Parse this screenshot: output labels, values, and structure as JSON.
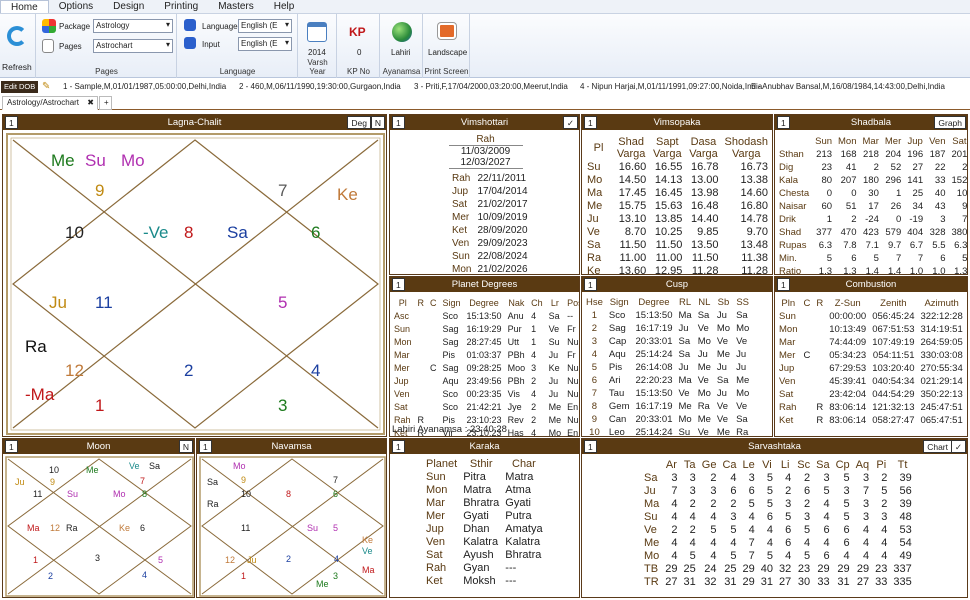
{
  "menu": [
    "Home",
    "Options",
    "Design",
    "Printing",
    "Masters",
    "Help"
  ],
  "ribbon": {
    "refresh": "Refresh",
    "package_label": "Package",
    "package_value": "Astrology",
    "pages_label": "Pages",
    "pages_value": "Astrochart",
    "pages_group": "Pages",
    "language_label": "Language",
    "language_value": "English (E",
    "input_label": "Input",
    "input_value": "English (E",
    "language_group": "Language",
    "varsh_year": "2014",
    "varsh_label": "Varsh Year",
    "kp_no": "0",
    "kp_label": "KP No",
    "ayanamsa_value": "Lahiri",
    "ayanamsa_label": "Ayanamsa",
    "print_value": "Landscape",
    "print_label": "Print Screen"
  },
  "dob": {
    "edit_label": "Edit DOB",
    "items": [
      "1 - Sample,M,01/01/1987,05:00:00,Delhi,India",
      "2 - 460,M,06/11/1990,19:30:00,Gurgaon,India",
      "3 - Priti,F,17/04/2000,03:20:00,Meerut,India",
      "4 - Nipun Harjai,M,01/11/1991,09:27:00,Noida,India",
      "5 - Anubhav Bansal,M,16/08/1984,14:43:00,Delhi,India"
    ]
  },
  "tabs": {
    "active": "Astrology/Astrochart",
    "close": "✖",
    "add": "+"
  },
  "lagna": {
    "title": "Lagna-Chalit",
    "num": "1",
    "btn1": "Deg",
    "btn2": "N",
    "houses": [
      "9",
      "7",
      "Ke",
      "10",
      "-Ve",
      "8",
      "Sa",
      "6",
      "Ju",
      "11",
      "5",
      "12",
      "2",
      "4",
      "1",
      "3"
    ],
    "planets_top": [
      "Me",
      "Su",
      "Mo"
    ],
    "left_planets": [
      "Ra",
      "-Ma"
    ]
  },
  "vimshottari": {
    "title": "Vimshottari",
    "num": "1",
    "check": "✓",
    "head": "Rah",
    "start": "11/03/2009",
    "end": "12/03/2027",
    "rows": [
      [
        "Rah",
        "22/11/2011"
      ],
      [
        "Jup",
        "17/04/2014"
      ],
      [
        "Sat",
        "21/02/2017"
      ],
      [
        "Mer",
        "10/09/2019"
      ],
      [
        "Ket",
        "28/09/2020"
      ],
      [
        "Ven",
        "29/09/2023"
      ],
      [
        "Sun",
        "22/08/2024"
      ],
      [
        "Mon",
        "21/02/2026"
      ],
      [
        "Mar",
        "12/03/2027"
      ]
    ]
  },
  "vimsopaka": {
    "title": "Vimsopaka",
    "num": "1",
    "headers": [
      "Pl",
      "Shad Varga",
      "Sapt Varga",
      "Dasa Varga",
      "Shodash Varga"
    ],
    "rows": [
      [
        "Su",
        "16.60",
        "16.55",
        "16.78",
        "16.73"
      ],
      [
        "Mo",
        "14.50",
        "14.13",
        "13.00",
        "13.38"
      ],
      [
        "Ma",
        "17.45",
        "16.45",
        "13.98",
        "14.60"
      ],
      [
        "Me",
        "15.75",
        "15.63",
        "16.48",
        "16.80"
      ],
      [
        "Ju",
        "13.10",
        "13.85",
        "14.40",
        "14.78"
      ],
      [
        "Ve",
        "8.70",
        "10.25",
        "9.85",
        "9.70"
      ],
      [
        "Sa",
        "11.50",
        "11.50",
        "13.50",
        "13.48"
      ],
      [
        "Ra",
        "11.00",
        "11.00",
        "11.50",
        "11.38"
      ],
      [
        "Ke",
        "13.60",
        "12.95",
        "11.28",
        "11.28"
      ]
    ]
  },
  "shadbala": {
    "title": "Shadbala",
    "num": "1",
    "btn": "Graph",
    "headers": [
      "",
      "Sun",
      "Mon",
      "Mar",
      "Mer",
      "Jup",
      "Ven",
      "Sat"
    ],
    "rows": [
      [
        "Sthan",
        "213",
        "168",
        "218",
        "204",
        "196",
        "187",
        "201"
      ],
      [
        "Dig",
        "23",
        "41",
        "2",
        "52",
        "27",
        "22",
        "2"
      ],
      [
        "Kala",
        "80",
        "207",
        "180",
        "296",
        "141",
        "33",
        "152"
      ],
      [
        "Chesta",
        "0",
        "0",
        "30",
        "1",
        "25",
        "40",
        "10"
      ],
      [
        "Naisar",
        "60",
        "51",
        "17",
        "26",
        "34",
        "43",
        "9"
      ],
      [
        "Drik",
        "1",
        "2",
        "-24",
        "0",
        "-19",
        "3",
        "7"
      ],
      [
        "Shad",
        "377",
        "470",
        "423",
        "579",
        "404",
        "328",
        "380"
      ],
      [
        "Rupas",
        "6.3",
        "7.8",
        "7.1",
        "9.7",
        "6.7",
        "5.5",
        "6.3"
      ],
      [
        "Min.",
        "5",
        "6",
        "5",
        "7",
        "7",
        "6",
        "5"
      ],
      [
        "Ratio",
        "1.3",
        "1.3",
        "1.4",
        "1.4",
        "1.0",
        "1.0",
        "1.3"
      ],
      [
        "Rank",
        "5",
        "3",
        "1",
        "2",
        "6",
        "7",
        "4"
      ]
    ]
  },
  "planet_degrees": {
    "title": "Planet Degrees",
    "num": "1",
    "headers": [
      "Pl",
      "R",
      "C",
      "Sign",
      "Degree",
      "Nak",
      "Ch",
      "Lr",
      "Pos"
    ],
    "rows": [
      [
        "Asc",
        "",
        "",
        "Sco",
        "15:13:50",
        "Anu",
        "4",
        "Sa",
        "--"
      ],
      [
        "Sun",
        "",
        "",
        "Sag",
        "16:19:29",
        "Pur",
        "1",
        "Ve",
        "Fr"
      ],
      [
        "Mon",
        "",
        "",
        "Sag",
        "28:27:45",
        "Utt",
        "1",
        "Su",
        "Nu"
      ],
      [
        "Mar",
        "",
        "",
        "Pis",
        "01:03:37",
        "PBh",
        "4",
        "Ju",
        "Fr"
      ],
      [
        "Mer",
        "",
        "C",
        "Sag",
        "09:28:25",
        "Moo",
        "3",
        "Ke",
        "Nu"
      ],
      [
        "Jup",
        "",
        "",
        "Aqu",
        "23:49:56",
        "PBh",
        "2",
        "Ju",
        "Nu"
      ],
      [
        "Ven",
        "",
        "",
        "Sco",
        "00:23:35",
        "Vis",
        "4",
        "Ju",
        "Nu"
      ],
      [
        "Sat",
        "",
        "",
        "Sco",
        "21:42:21",
        "Jye",
        "2",
        "Me",
        "En"
      ],
      [
        "Rah",
        "R",
        "",
        "Pis",
        "23:10:23",
        "Rev",
        "2",
        "Me",
        "Nu"
      ],
      [
        "Ket",
        "R",
        "",
        "Vir",
        "23:10:23",
        "Has",
        "4",
        "Mo",
        "En"
      ]
    ],
    "footer": "Lahiri Ayanamsa : 23:40:28"
  },
  "cusp": {
    "title": "Cusp",
    "num": "1",
    "headers": [
      "Hse",
      "Sign",
      "Degree",
      "RL",
      "NL",
      "Sb",
      "SS"
    ],
    "rows": [
      [
        "1",
        "Sco",
        "15:13:50",
        "Ma",
        "Sa",
        "Ju",
        "Sa"
      ],
      [
        "2",
        "Sag",
        "16:17:19",
        "Ju",
        "Ve",
        "Mo",
        "Mo"
      ],
      [
        "3",
        "Cap",
        "20:33:01",
        "Sa",
        "Mo",
        "Ve",
        "Ve"
      ],
      [
        "4",
        "Aqu",
        "25:14:24",
        "Sa",
        "Ju",
        "Me",
        "Ju"
      ],
      [
        "5",
        "Pis",
        "26:14:08",
        "Ju",
        "Me",
        "Ju",
        "Ju"
      ],
      [
        "6",
        "Ari",
        "22:20:23",
        "Ma",
        "Ve",
        "Sa",
        "Me"
      ],
      [
        "7",
        "Tau",
        "15:13:50",
        "Ve",
        "Mo",
        "Ju",
        "Mo"
      ],
      [
        "8",
        "Gem",
        "16:17:19",
        "Me",
        "Ra",
        "Ve",
        "Ve"
      ],
      [
        "9",
        "Can",
        "20:33:01",
        "Mo",
        "Me",
        "Ve",
        "Sa"
      ],
      [
        "10",
        "Leo",
        "25:14:24",
        "Su",
        "Ve",
        "Me",
        "Ra"
      ],
      [
        "11",
        "Vir",
        "26:14:08",
        "Me",
        "Ma",
        "Ju",
        "Ju"
      ],
      [
        "12",
        "Lib",
        "22:20:23",
        "Ve",
        "Ju",
        "Sa",
        "Me"
      ]
    ]
  },
  "combustion": {
    "title": "Combustion",
    "num": "1",
    "headers": [
      "Pln",
      "C",
      "R",
      "Z-Sun",
      "Zenith",
      "Azimuth"
    ],
    "rows": [
      [
        "Sun",
        "",
        "",
        "00:00:00",
        "056:45:24",
        "322:12:28"
      ],
      [
        "Mon",
        "",
        "",
        "10:13:49",
        "067:51:53",
        "314:19:51"
      ],
      [
        "Mar",
        "",
        "",
        "74:44:09",
        "107:49:19",
        "264:59:05"
      ],
      [
        "Mer",
        "C",
        "",
        "05:34:23",
        "054:11:51",
        "330:03:08"
      ],
      [
        "Jup",
        "",
        "",
        "67:29:53",
        "103:20:40",
        "270:55:34"
      ],
      [
        "Ven",
        "",
        "",
        "45:39:41",
        "040:54:34",
        "021:29:14"
      ],
      [
        "Sat",
        "",
        "",
        "23:42:04",
        "044:54:29",
        "350:22:13"
      ],
      [
        "Rah",
        "",
        "R",
        "83:06:14",
        "121:32:13",
        "245:47:51"
      ],
      [
        "Ket",
        "",
        "R",
        "83:06:14",
        "058:27:47",
        "065:47:51"
      ]
    ]
  },
  "moon": {
    "title": "Moon",
    "num": "1",
    "btn": "N",
    "houses": [
      "9",
      "7",
      "11",
      "8",
      "Sa",
      "10",
      "6",
      "12",
      "Ke",
      "2",
      "4",
      "1",
      "3",
      "5"
    ],
    "planets": [
      "Me",
      "Ve",
      "Ju",
      "Su",
      "Mo",
      "Ma",
      "Ra"
    ]
  },
  "navamsa": {
    "title": "Navamsa",
    "num": "1",
    "houses": [
      "9",
      "7",
      "10",
      "8",
      "6",
      "11",
      "Su",
      "5",
      "12",
      "2",
      "4",
      "1",
      "3"
    ],
    "planets": [
      "Mo",
      "Sa",
      "Ra",
      "Ju",
      "Ke",
      "Ve",
      "Ma",
      "Me"
    ]
  },
  "karaka": {
    "title": "Karaka",
    "num": "1",
    "headers": [
      "Planet",
      "Sthir",
      "Char"
    ],
    "rows": [
      [
        "Sun",
        "Pitra",
        "Matra"
      ],
      [
        "Mon",
        "Matra",
        "Atma"
      ],
      [
        "Mar",
        "Bhratra",
        "Gyati"
      ],
      [
        "Mer",
        "Gyati",
        "Putra"
      ],
      [
        "Jup",
        "Dhan",
        "Amatya"
      ],
      [
        "Ven",
        "Kalatra",
        "Kalatra"
      ],
      [
        "Sat",
        "Ayush",
        "Bhratra"
      ],
      [
        "Rah",
        "Gyan",
        "---"
      ],
      [
        "Ket",
        "Moksh",
        "---"
      ]
    ]
  },
  "sarvashtaka": {
    "title": "Sarvashtaka",
    "num": "1",
    "btn": "Chart",
    "check": "✓",
    "headers": [
      "",
      "Ar",
      "Ta",
      "Ge",
      "Ca",
      "Le",
      "Vi",
      "Li",
      "Sc",
      "Sa",
      "Cp",
      "Aq",
      "Pi",
      "Tt"
    ],
    "rows": [
      [
        "Sa",
        "3",
        "3",
        "2",
        "4",
        "3",
        "5",
        "4",
        "2",
        "3",
        "5",
        "3",
        "2",
        "39"
      ],
      [
        "Ju",
        "7",
        "3",
        "3",
        "6",
        "6",
        "5",
        "2",
        "6",
        "5",
        "3",
        "7",
        "5",
        "56"
      ],
      [
        "Ma",
        "4",
        "2",
        "2",
        "2",
        "5",
        "5",
        "3",
        "2",
        "4",
        "5",
        "3",
        "2",
        "39"
      ],
      [
        "Su",
        "4",
        "4",
        "4",
        "3",
        "4",
        "6",
        "5",
        "3",
        "4",
        "5",
        "3",
        "3",
        "48"
      ],
      [
        "Ve",
        "2",
        "2",
        "5",
        "5",
        "4",
        "4",
        "6",
        "5",
        "6",
        "6",
        "4",
        "4",
        "53"
      ],
      [
        "Me",
        "4",
        "4",
        "4",
        "4",
        "7",
        "4",
        "6",
        "4",
        "4",
        "6",
        "4",
        "4",
        "54"
      ],
      [
        "Mo",
        "4",
        "5",
        "4",
        "5",
        "7",
        "5",
        "4",
        "5",
        "6",
        "4",
        "4",
        "4",
        "49"
      ],
      [
        "TB",
        "29",
        "25",
        "24",
        "25",
        "29",
        "40",
        "32",
        "23",
        "29",
        "29",
        "29",
        "23",
        "337"
      ],
      [
        "TR",
        "27",
        "31",
        "32",
        "31",
        "29",
        "31",
        "27",
        "30",
        "33",
        "31",
        "27",
        "33",
        "335"
      ]
    ]
  },
  "colors": {
    "header": "#5a3a12",
    "red": "#c0181a",
    "green": "#1d7a1d",
    "blue": "#1b3fa0",
    "magenta": "#b02fb0",
    "orange": "#c08a12",
    "teal": "#1a8a8a"
  }
}
